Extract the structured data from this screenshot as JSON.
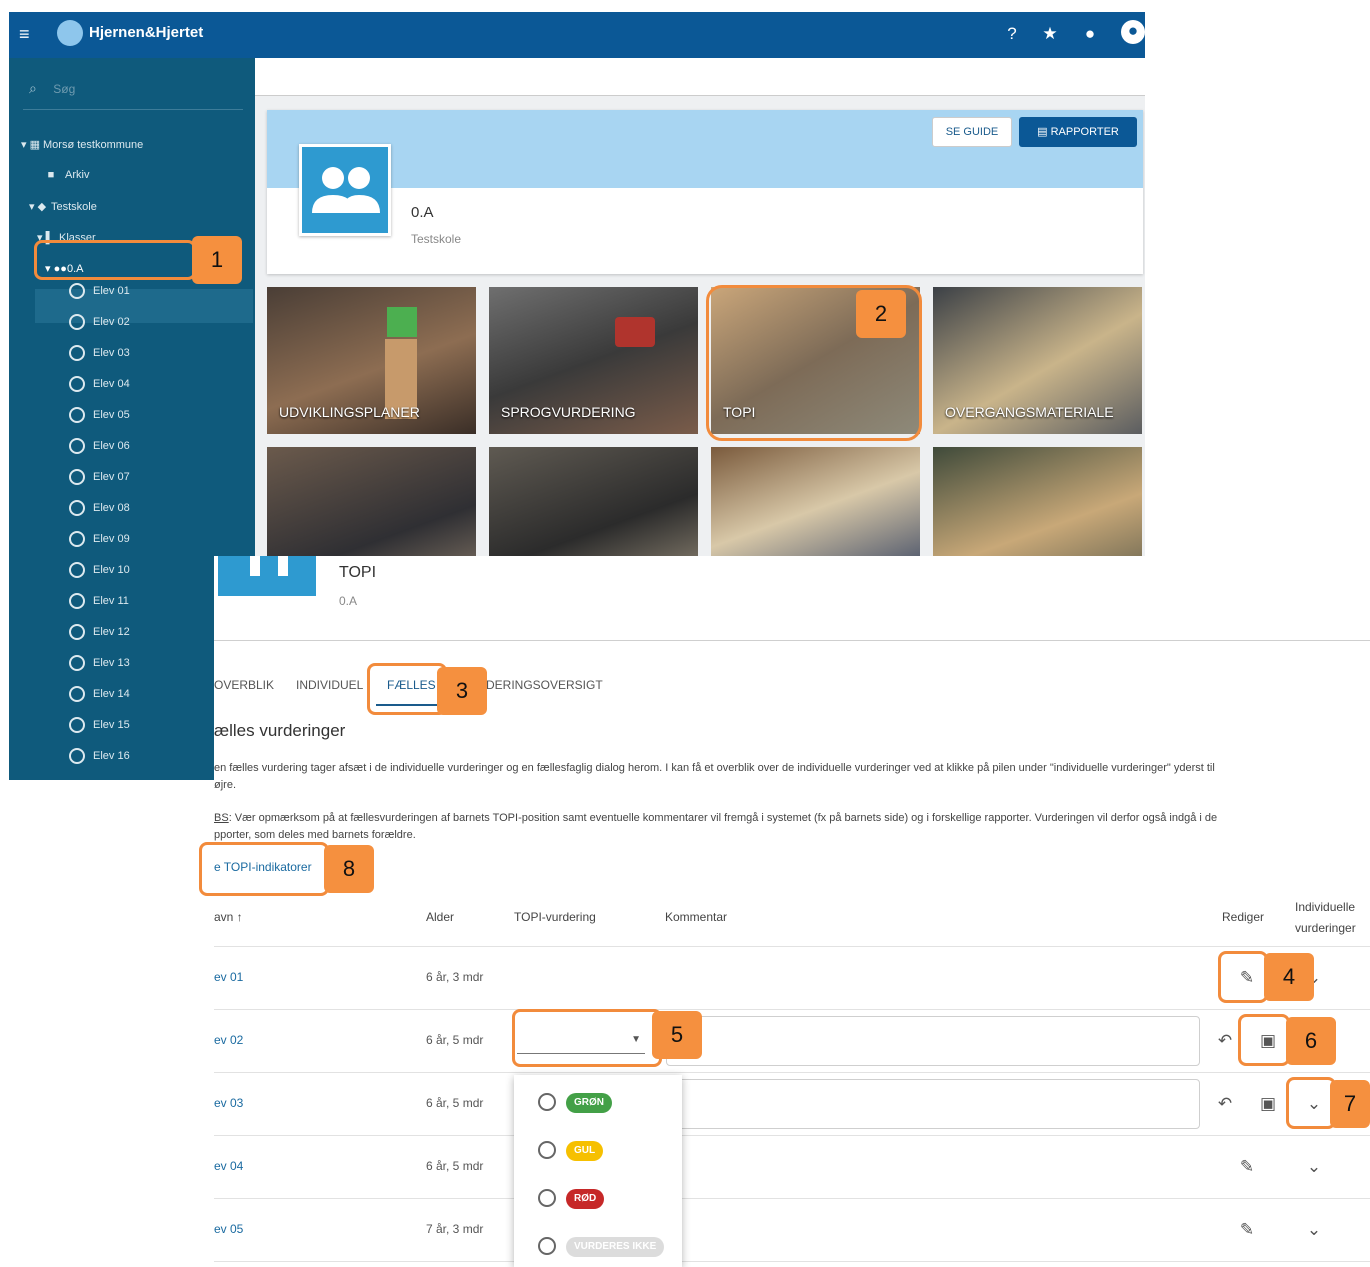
{
  "app": {
    "brand": "Hjernen&Hjertet"
  },
  "colors": {
    "topbar": "#0b5896",
    "sidebar": "#0f5a7c",
    "accent": "#f28b3c",
    "link": "#1a6aa0"
  },
  "search": {
    "placeholder": "Søg"
  },
  "tree": {
    "kommune": "Morsø testkommune",
    "arkiv": "Arkiv",
    "skole": "Testskole",
    "klasser": "Klasser",
    "klasse": "0.A"
  },
  "students": [
    "Elev 01",
    "Elev 02",
    "Elev 03",
    "Elev 04",
    "Elev 05",
    "Elev 06",
    "Elev 07",
    "Elev 08",
    "Elev 09",
    "Elev 10",
    "Elev 11",
    "Elev 12",
    "Elev 13",
    "Elev 14",
    "Elev 15",
    "Elev 16"
  ],
  "class_card": {
    "title": "0.A",
    "subtitle": "Testskole",
    "guide_label": "SE GUIDE",
    "report_label": "RAPPORTER"
  },
  "tiles": [
    "UDVIKLINGSPLANER",
    "SPROGVURDERING",
    "TOPI",
    "OVERGANGSMATERIALE"
  ],
  "topi": {
    "title": "TOPI",
    "subtitle": "0.A",
    "tabs": [
      "OVERBLIK",
      "INDIVIDUEL",
      "FÆLLES",
      "DERINGSOVERSIGT"
    ],
    "heading": "ælles vurderinger",
    "para1": "en fælles vurdering tager afsæt i de individuelle vurderinger og en fællesfaglig dialog herom. I kan få et overblik over de individuelle vurderinger ved at klikke på pilen under \"individuelle vurderinger\" yderst til",
    "para1b": "øjre.",
    "para2a": "BS",
    "para2": ": Vær opmærksom på at fællesvurderingen af barnets TOPI-position samt eventuelle kommentarer vil fremgå i systemet (fx på barnets side) og i forskellige rapporter. Vurderingen vil derfor også indgå i de",
    "para2b": "pporter, som deles med barnets forældre.",
    "indicator_link": "e TOPI-indikatorer",
    "columns": {
      "name": "avn ↑",
      "age": "Alder",
      "topi": "TOPI-vurdering",
      "comment": "Kommentar",
      "edit": "Rediger",
      "indiv1": "Individuelle",
      "indiv2": "vurderinger"
    },
    "rows": [
      {
        "name": "ev 01",
        "age": "6 år, 3 mdr"
      },
      {
        "name": "ev 02",
        "age": "6 år, 5 mdr"
      },
      {
        "name": "ev 03",
        "age": "6 år, 5 mdr"
      },
      {
        "name": "ev 04",
        "age": "6 år, 5 mdr"
      },
      {
        "name": "ev 05",
        "age": "7 år, 3 mdr"
      }
    ],
    "options": [
      {
        "label": "GRØN",
        "color": "#43a047",
        "text": "#ffffff"
      },
      {
        "label": "GUL",
        "color": "#f6c000",
        "text": "#ffffff"
      },
      {
        "label": "RØD",
        "color": "#c62828",
        "text": "#ffffff"
      },
      {
        "label": "VURDERES IKKE",
        "color": "#dcdcdc",
        "text": "#ffffff"
      }
    ]
  },
  "callouts": [
    "1",
    "2",
    "3",
    "4",
    "5",
    "6",
    "7",
    "8"
  ]
}
